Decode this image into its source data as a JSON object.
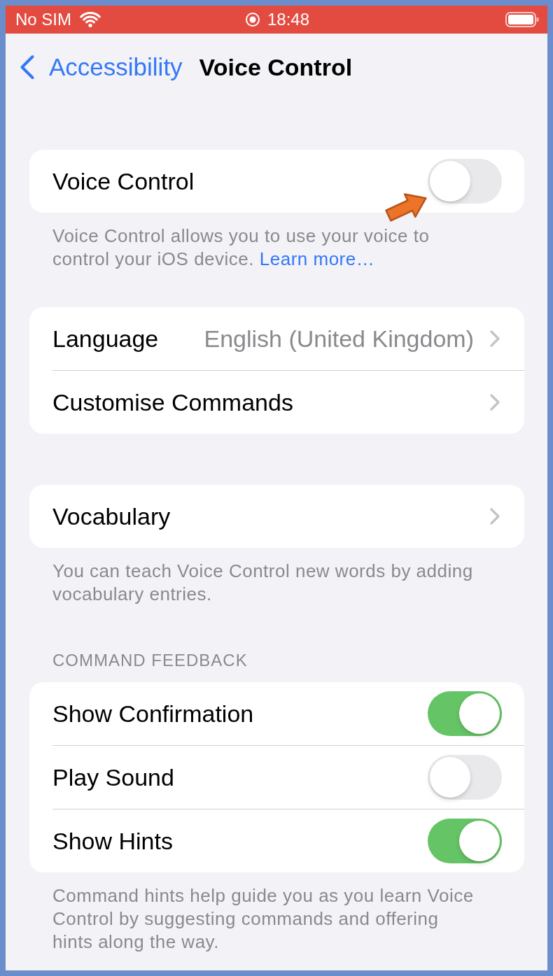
{
  "status_bar": {
    "carrier": "No SIM",
    "time": "18:48"
  },
  "nav_bar": {
    "back_label": "Accessibility",
    "title": "Voice Control"
  },
  "sections": [
    {
      "rows": [
        {
          "kind": "toggle",
          "label": "Voice Control",
          "on": false,
          "arrow": true
        }
      ],
      "footer": {
        "text": "Voice Control allows you to use your voice to control your iOS device.",
        "link": "Learn more…"
      }
    },
    {
      "rows": [
        {
          "kind": "link",
          "label": "Language",
          "value": "English (United Kingdom)",
          "arrow": false
        },
        {
          "kind": "link",
          "label": "Customise Commands",
          "arrow": false
        }
      ]
    },
    {
      "rows": [
        {
          "kind": "link",
          "label": "Vocabulary",
          "arrow": false
        }
      ],
      "footer": {
        "text": "You can teach Voice Control new words by adding vocabulary entries."
      }
    },
    {
      "header": "COMMAND FEEDBACK",
      "rows": [
        {
          "kind": "toggle",
          "label": "Show Confirmation",
          "on": true,
          "arrow": false
        },
        {
          "kind": "toggle",
          "label": "Play Sound",
          "on": false,
          "arrow": false
        },
        {
          "kind": "toggle",
          "label": "Show Hints",
          "on": true,
          "arrow": false
        }
      ],
      "footer": {
        "text": "Command hints help guide you as you learn Voice Control by suggesting commands and offering hints along the way."
      }
    }
  ]
}
